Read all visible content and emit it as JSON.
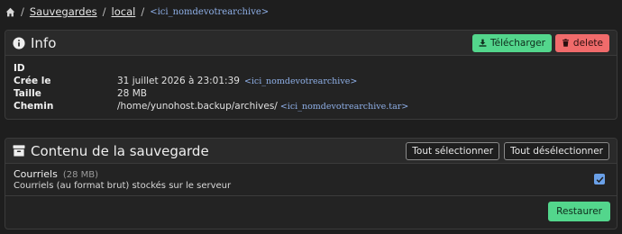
{
  "breadcrumb": {
    "home_icon": "home-icon",
    "items": [
      {
        "label": "Sauvegardes"
      },
      {
        "label": "local"
      },
      {
        "label": "<ici_nomdevotrearchive>"
      }
    ],
    "separator": "/"
  },
  "info": {
    "title": "Info",
    "icon": "info-circle-icon",
    "download_label": "Télécharger",
    "delete_label": "delete",
    "rows": [
      {
        "key": "ID",
        "value": "",
        "tag": ""
      },
      {
        "key": "Crée le",
        "value": "31 juillet 2026 à 23:01:39",
        "tag": "<ici_nomdevotrearchive>"
      },
      {
        "key": "Taille",
        "value": "28 MB",
        "tag": ""
      },
      {
        "key": "Chemin",
        "value": "/home/yunohost.backup/archives/",
        "tag": "<ici_nomdevotrearchive.tar>"
      }
    ]
  },
  "content": {
    "title": "Contenu de la sauvegarde",
    "icon": "archive-icon",
    "select_all_label": "Tout sélectionner",
    "deselect_all_label": "Tout désélectionner",
    "items": [
      {
        "name": "Courriels",
        "size": "(28 MB)",
        "description": "Courriels (au format brut) stockés sur le serveur",
        "checked": true
      }
    ],
    "restore_label": "Restaurer"
  },
  "colors": {
    "background": "#1e1e1e",
    "success": "#53d68c",
    "danger": "#f06b6b",
    "link": "#8fb0e8",
    "checkbox": "#6aa0e8"
  }
}
